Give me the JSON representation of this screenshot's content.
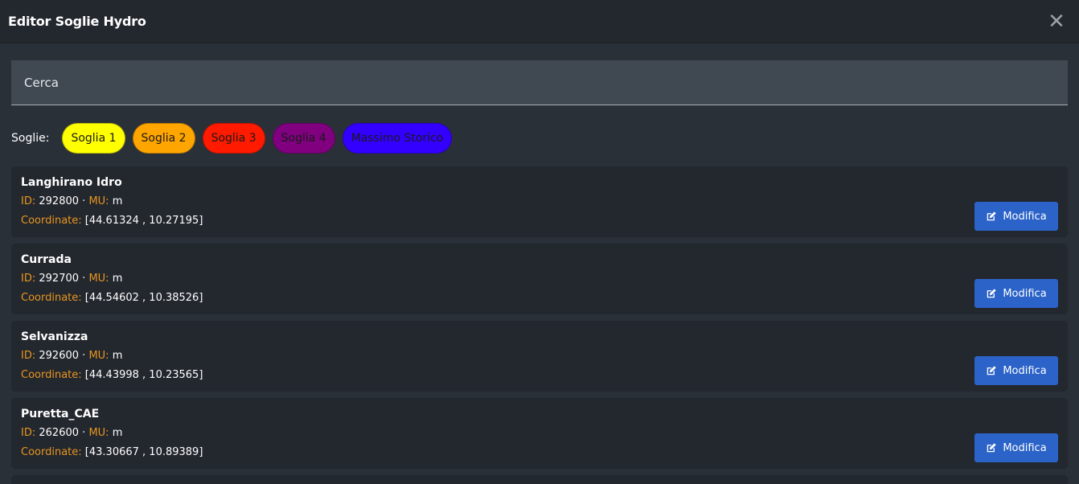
{
  "header": {
    "title": "Editor Soglie Hydro",
    "close_glyph": "✕"
  },
  "search": {
    "placeholder": "Cerca",
    "value": ""
  },
  "legend": {
    "label": "Soglie:",
    "items": [
      {
        "label": "Soglia 1",
        "color": "#ffff00"
      },
      {
        "label": "Soglia 2",
        "color": "#ffa500"
      },
      {
        "label": "Soglia 3",
        "color": "#ff1a00"
      },
      {
        "label": "Soglia 4",
        "color": "#800080"
      },
      {
        "label": "Massimo Storico",
        "color": "#3300ff"
      }
    ]
  },
  "field_labels": {
    "id": "ID:",
    "mu": "MU:",
    "coord": "Coordinate:",
    "separator": "·"
  },
  "edit_button_label": "Modifica",
  "stations": [
    {
      "name": "Langhirano Idro",
      "id": "292800",
      "mu": "m",
      "coordinates": "[44.61324 , 10.27195]"
    },
    {
      "name": "Currada",
      "id": "292700",
      "mu": "m",
      "coordinates": "[44.54602 , 10.38526]"
    },
    {
      "name": "Selvanizza",
      "id": "292600",
      "mu": "m",
      "coordinates": "[44.43998 , 10.23565]"
    },
    {
      "name": "Puretta_CAE",
      "id": "262600",
      "mu": "m",
      "coordinates": "[43.30667 , 10.89389]"
    }
  ],
  "icons": {
    "close": "close-icon",
    "edit": "edit-icon"
  }
}
